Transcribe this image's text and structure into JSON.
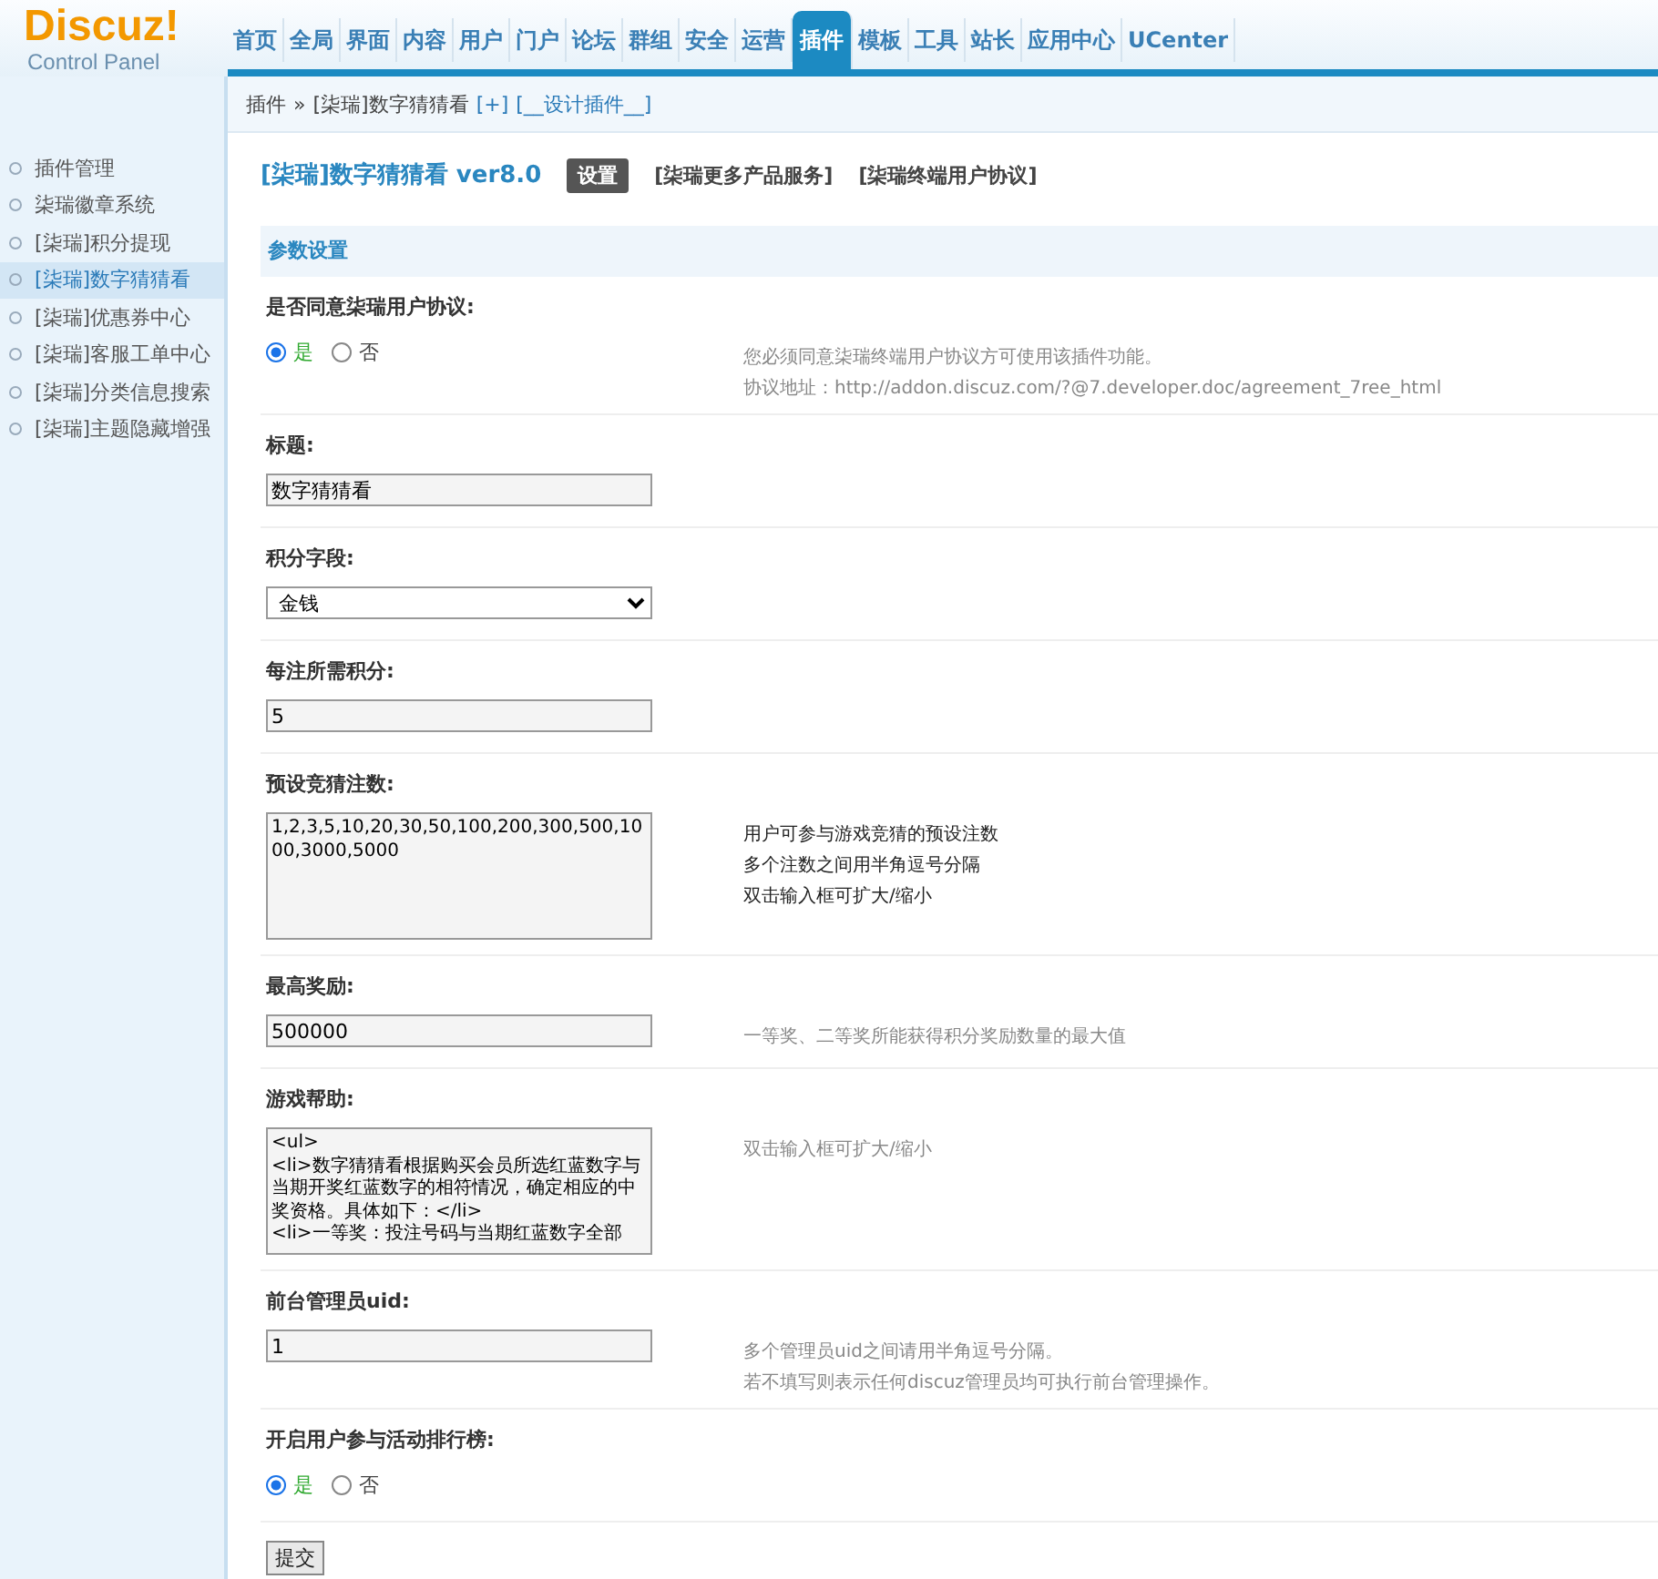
{
  "logo": {
    "name": "Discuz!",
    "subtitle": "Control Panel"
  },
  "nav": [
    {
      "label": "首页",
      "selected": false
    },
    {
      "label": "全局",
      "selected": false
    },
    {
      "label": "界面",
      "selected": false
    },
    {
      "label": "内容",
      "selected": false
    },
    {
      "label": "用户",
      "selected": false
    },
    {
      "label": "门户",
      "selected": false
    },
    {
      "label": "论坛",
      "selected": false
    },
    {
      "label": "群组",
      "selected": false
    },
    {
      "label": "安全",
      "selected": false
    },
    {
      "label": "运营",
      "selected": false
    },
    {
      "label": "插件",
      "selected": true
    },
    {
      "label": "模板",
      "selected": false
    },
    {
      "label": "工具",
      "selected": false
    },
    {
      "label": "站长",
      "selected": false
    },
    {
      "label": "应用中心",
      "selected": false
    },
    {
      "label": "UCenter",
      "selected": false
    }
  ],
  "breadcrumb": {
    "items": [
      "插件",
      "[柒瑞]数字猜猜看"
    ],
    "separator": "»",
    "actions": [
      "[+]",
      "[__设计插件__]"
    ]
  },
  "sidebar": {
    "items": [
      {
        "label": "插件管理",
        "selected": false
      },
      {
        "label": "柒瑞徽章系统",
        "selected": false
      },
      {
        "label": "[柒瑞]积分提现",
        "selected": false
      },
      {
        "label": "[柒瑞]数字猜猜看",
        "selected": true
      },
      {
        "label": "[柒瑞]优惠券中心",
        "selected": false
      },
      {
        "label": "[柒瑞]客服工单中心",
        "selected": false
      },
      {
        "label": "[柒瑞]分类信息搜索",
        "selected": false
      },
      {
        "label": "[柒瑞]主题隐藏增强",
        "selected": false
      }
    ]
  },
  "plugin": {
    "title": "[柒瑞]数字猜猜看 ver8.0",
    "tabs": [
      {
        "label": "设置",
        "selected": true
      },
      {
        "label": "[柒瑞更多产品服务]",
        "selected": false
      },
      {
        "label": "[柒瑞终端用户协议]",
        "selected": false
      }
    ]
  },
  "section_title": "参数设置",
  "settings": [
    {
      "label": "是否同意柒瑞用户协议:",
      "kind": "radio",
      "options": [
        {
          "label": "是",
          "selected": true
        },
        {
          "label": "否",
          "selected": false
        }
      ],
      "notes": [
        "您必须同意柒瑞终端用户协议方可使用该插件功能。",
        "协议地址：http://addon.discuz.com/?@7.developer.doc/agreement_7ree_html"
      ],
      "note_dark": false
    },
    {
      "label": "标题:",
      "kind": "text",
      "value": "数字猜猜看"
    },
    {
      "label": "积分字段:",
      "kind": "select",
      "value": "金钱"
    },
    {
      "label": "每注所需积分:",
      "kind": "text",
      "value": "5"
    },
    {
      "label": "预设竞猜注数:",
      "kind": "textarea",
      "value": "1,2,3,5,10,20,30,50,100,200,300,500,1000,3000,5000",
      "notes": [
        "用户可参与游戏竞猜的预设注数",
        "多个注数之间用半角逗号分隔",
        "双击输入框可扩大/缩小"
      ],
      "note_dark": true
    },
    {
      "label": "最高奖励:",
      "kind": "text",
      "value": "500000",
      "notes": [
        "一等奖、二等奖所能获得积分奖励数量的最大值"
      ],
      "note_dark": false
    },
    {
      "label": "游戏帮助:",
      "kind": "textarea",
      "value": "<ul>\n<li>数字猜猜看根据购买会员所选红蓝数字与当期开奖红蓝数字的相符情况，确定相应的中奖资格。具体如下：</li>\n<li>一等奖：投注号码与当期红蓝数字全部",
      "notes": [
        "双击输入框可扩大/缩小"
      ],
      "note_dark": false
    },
    {
      "label": "前台管理员uid:",
      "kind": "text",
      "value": "1",
      "notes": [
        "多个管理员uid之间请用半角逗号分隔。",
        "若不填写则表示任何discuz管理员均可执行前台管理操作。"
      ],
      "note_dark": false
    },
    {
      "label": "开启用户参与活动排行榜:",
      "kind": "radio",
      "options": [
        {
          "label": "是",
          "selected": true
        },
        {
          "label": "否",
          "selected": false
        }
      ]
    }
  ],
  "submit": "提交"
}
